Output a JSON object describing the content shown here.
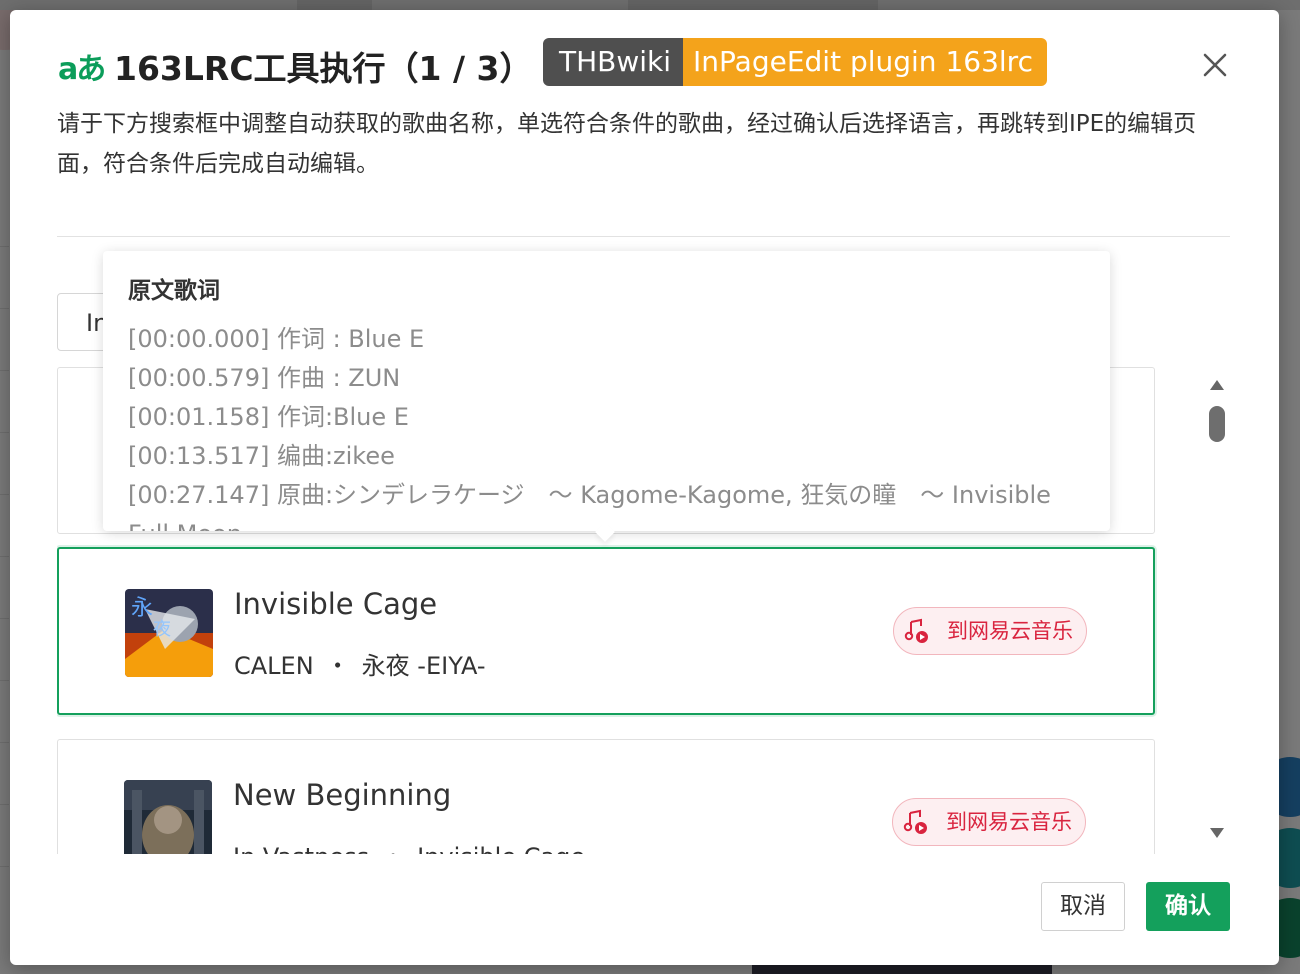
{
  "dialog": {
    "icon_text": "aあ",
    "title": "163LRC工具执行（1 / 3）",
    "badge_left": "THBwiki",
    "badge_right": "InPageEdit plugin 163lrc",
    "description": "请于下方搜索框中调整自动获取的歌曲名称，单选符合条件的歌曲，经过确认后选择语言，再跳转到IPE的编辑页面，符合条件后完成自动编辑。",
    "close_icon": "close-icon"
  },
  "search": {
    "value": "In"
  },
  "popover": {
    "title": "原文歌词",
    "lines": [
      "[00:00.000] 作词 : Blue E",
      "[00:00.579] 作曲 : ZUN",
      "[00:01.158] 作词:Blue E",
      "[00:13.517] 编曲:zikee",
      "[00:27.147] 原曲:シンデレラケージ　～ Kagome-Kagome, 狂気の瞳　～ Invisible Full Moon"
    ]
  },
  "results": [
    {
      "name": "Invisible Cage",
      "artist": "CALEN",
      "separator": "・",
      "album": "永夜 -EIYA-",
      "link_label": "到网易云音乐",
      "selected": true
    },
    {
      "name": "New Beginning",
      "artist": "In Vastness",
      "separator": "・",
      "album": "Invisible Cage",
      "link_label": "到网易云音乐",
      "selected": false
    }
  ],
  "footer": {
    "cancel_label": "取消",
    "confirm_label": "确认"
  },
  "colors": {
    "accent_green": "#14a05c",
    "badge_dark": "#4f4f4f",
    "badge_orange": "#f4a31b",
    "netease_red": "#d9243f"
  }
}
